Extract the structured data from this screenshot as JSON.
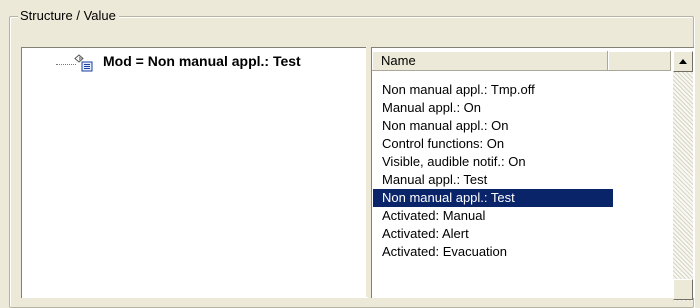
{
  "group": {
    "title": "Structure / Value"
  },
  "tree": {
    "node_label": "Mod = Non manual appl.: Test",
    "node_icon": "property-node-icon"
  },
  "list": {
    "columns": [
      "Name",
      ""
    ],
    "items": [
      "Non manual appl.: Tmp.off",
      "Manual appl.: On",
      "Non manual appl.: On",
      "Control functions: On",
      "Visible, audible notif.: On",
      "Manual appl.: Test",
      "Non manual appl.: Test",
      "Activated: Manual",
      "Activated: Alert",
      "Activated: Evacuation"
    ],
    "selected_index": 6,
    "selected_color": "#0a246a"
  },
  "scrollbar": {
    "up_icon": "scroll-up-arrow-icon",
    "down_icon": "scroll-down-button"
  }
}
